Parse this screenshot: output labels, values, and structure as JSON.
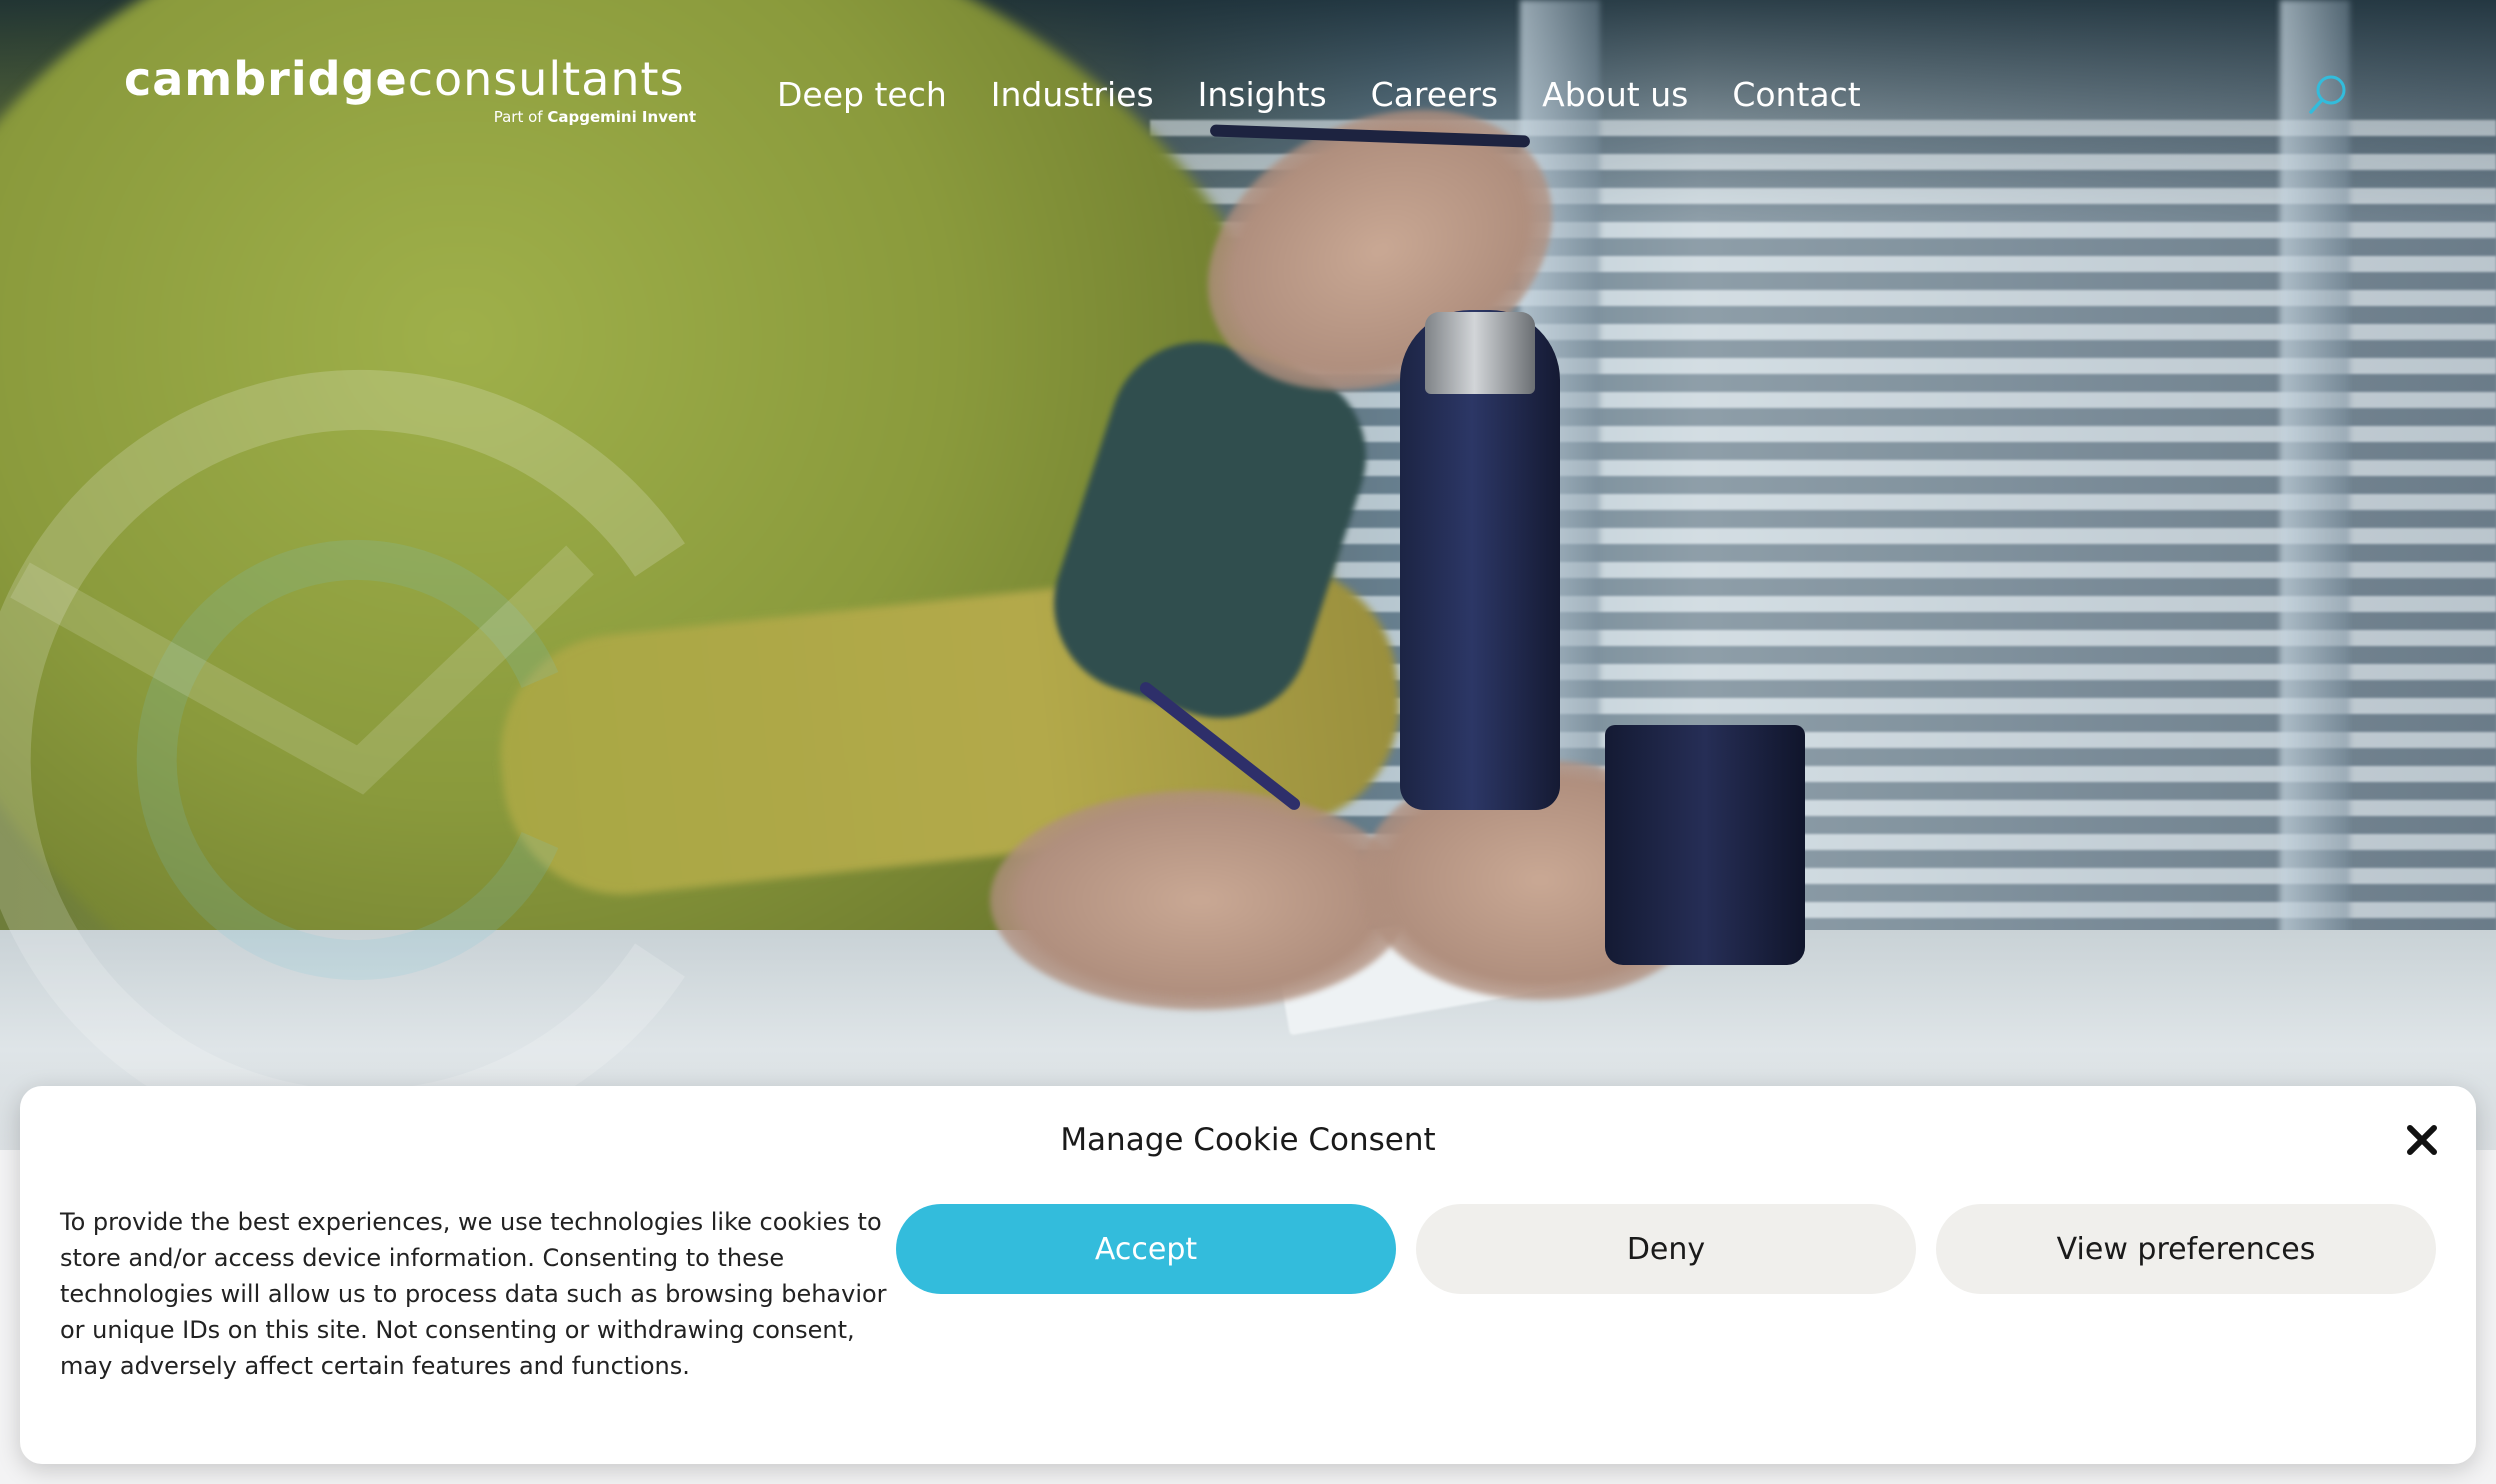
{
  "header": {
    "logo": {
      "word_bold": "cambridge",
      "word_light": "consultants",
      "sub_prefix": "Part of",
      "sub_brand": "Capgemini Invent"
    },
    "nav": {
      "items": [
        {
          "label": "Deep tech"
        },
        {
          "label": "Industries"
        },
        {
          "label": "Insights"
        },
        {
          "label": "Careers"
        },
        {
          "label": "About us"
        },
        {
          "label": "Contact"
        }
      ]
    },
    "search_icon": "search-icon"
  },
  "cookie_consent": {
    "title": "Manage Cookie Consent",
    "body": "To provide the best experiences, we use technologies like cookies to store and/or access device information. Consenting to these technologies will allow us to process data such as browsing behavior or unique IDs on this site. Not consenting or withdrawing consent, may adversely affect certain features and functions.",
    "accept_label": "Accept",
    "deny_label": "Deny",
    "preferences_label": "View preferences",
    "close_icon": "close-icon"
  },
  "colors": {
    "accent": "#33bcdc",
    "secondary_button": "#f0efec",
    "search_icon": "#33bcdc"
  }
}
